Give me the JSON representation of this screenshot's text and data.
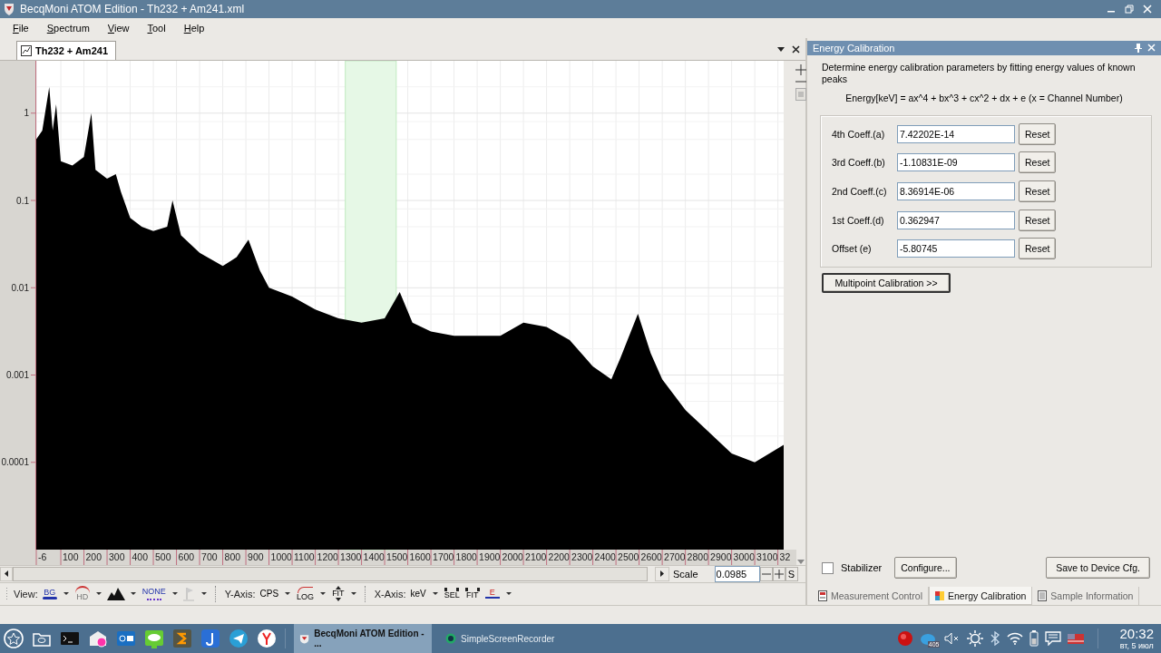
{
  "window": {
    "title": "BecqMoni ATOM Edition - Th232 + Am241.xml"
  },
  "menu": [
    {
      "label": "File"
    },
    {
      "label": "Spectrum"
    },
    {
      "label": "View"
    },
    {
      "label": "Tool"
    },
    {
      "label": "Help"
    }
  ],
  "document_tab": {
    "label": "Th232 + Am241",
    "selected": true
  },
  "spectrum": {
    "y_axis_labels": [
      "1",
      "0.1",
      "0.01",
      "0.001",
      "0.0001"
    ],
    "x_axis_labels": [
      "-6",
      "100",
      "200",
      "300",
      "400",
      "500",
      "600",
      "700",
      "800",
      "900",
      "1000",
      "1100",
      "1200",
      "1300",
      "1400",
      "1500",
      "1600",
      "1700",
      "1800",
      "1900",
      "2000",
      "2100",
      "2200",
      "2300",
      "2400",
      "2500",
      "2600",
      "2700",
      "2800",
      "2900",
      "3000",
      "3100",
      "32"
    ]
  },
  "scale": {
    "label": "Scale",
    "value": "0.0985",
    "reset": "S"
  },
  "toolbar": [
    {
      "kind": "label",
      "text": "View:"
    },
    {
      "kind": "bg",
      "text": "BG",
      "dropdown": true
    },
    {
      "kind": "arc",
      "text": "HD",
      "dropdown": true
    },
    {
      "kind": "mountain",
      "dropdown": true
    },
    {
      "kind": "wave",
      "text": "NONE",
      "dropdown": true
    },
    {
      "kind": "flag",
      "dropdown": true
    },
    {
      "kind": "separator"
    },
    {
      "kind": "label",
      "text": "Y-Axis:"
    },
    {
      "kind": "plain",
      "text": "CPS",
      "dropdown": true
    },
    {
      "kind": "curve",
      "text": "LOG",
      "dropdown": true
    },
    {
      "kind": "updown",
      "text": "FIT",
      "dropdown": true
    },
    {
      "kind": "separator"
    },
    {
      "kind": "label",
      "text": "X-Axis:"
    },
    {
      "kind": "plain",
      "text": "keV",
      "dropdown": true
    },
    {
      "kind": "leftright",
      "text": "SEL",
      "dropdown": false
    },
    {
      "kind": "leftright",
      "text": "FIT",
      "dropdown": false
    },
    {
      "kind": "arrow",
      "text": "E",
      "dropdown": true
    }
  ],
  "panel": {
    "title": "Energy Calibration",
    "description": "Determine energy calibration parameters by fitting energy values of known peaks",
    "formula": "Energy[keV] = ax^4 + bx^3 + cx^2 + dx + e (x = Channel Number)",
    "coefficients": [
      {
        "label": "4th Coeff.(a)",
        "value": "7.42202E-14",
        "button": "Reset"
      },
      {
        "label": "3rd Coeff.(b)",
        "value": "-1.10831E-09",
        "button": "Reset"
      },
      {
        "label": "2nd Coeff.(c)",
        "value": "8.36914E-06",
        "button": "Reset"
      },
      {
        "label": "1st Coeff.(d)",
        "value": "0.362947",
        "button": "Reset"
      },
      {
        "label": "Offset (e)",
        "value": "-5.80745",
        "button": "Reset"
      }
    ],
    "multipoint_button": "Multipoint Calibration >>",
    "stabilizer": {
      "label": "Stabilizer",
      "checked": false
    },
    "configure_button": "Configure...",
    "save_button": "Save to Device Cfg.",
    "tabs": [
      {
        "label": "Measurement Control",
        "selected": false
      },
      {
        "label": "Energy Calibration",
        "selected": true
      },
      {
        "label": "Sample Information",
        "selected": false
      }
    ]
  },
  "taskbar": {
    "tasks": [
      {
        "label": "BecqMoni ATOM Edition - ...",
        "selected": true
      },
      {
        "label": "SimpleScreenRecorder",
        "selected": false
      }
    ],
    "tray_badge": "405",
    "time": "20:32",
    "date": "вт, 5 июл"
  }
}
